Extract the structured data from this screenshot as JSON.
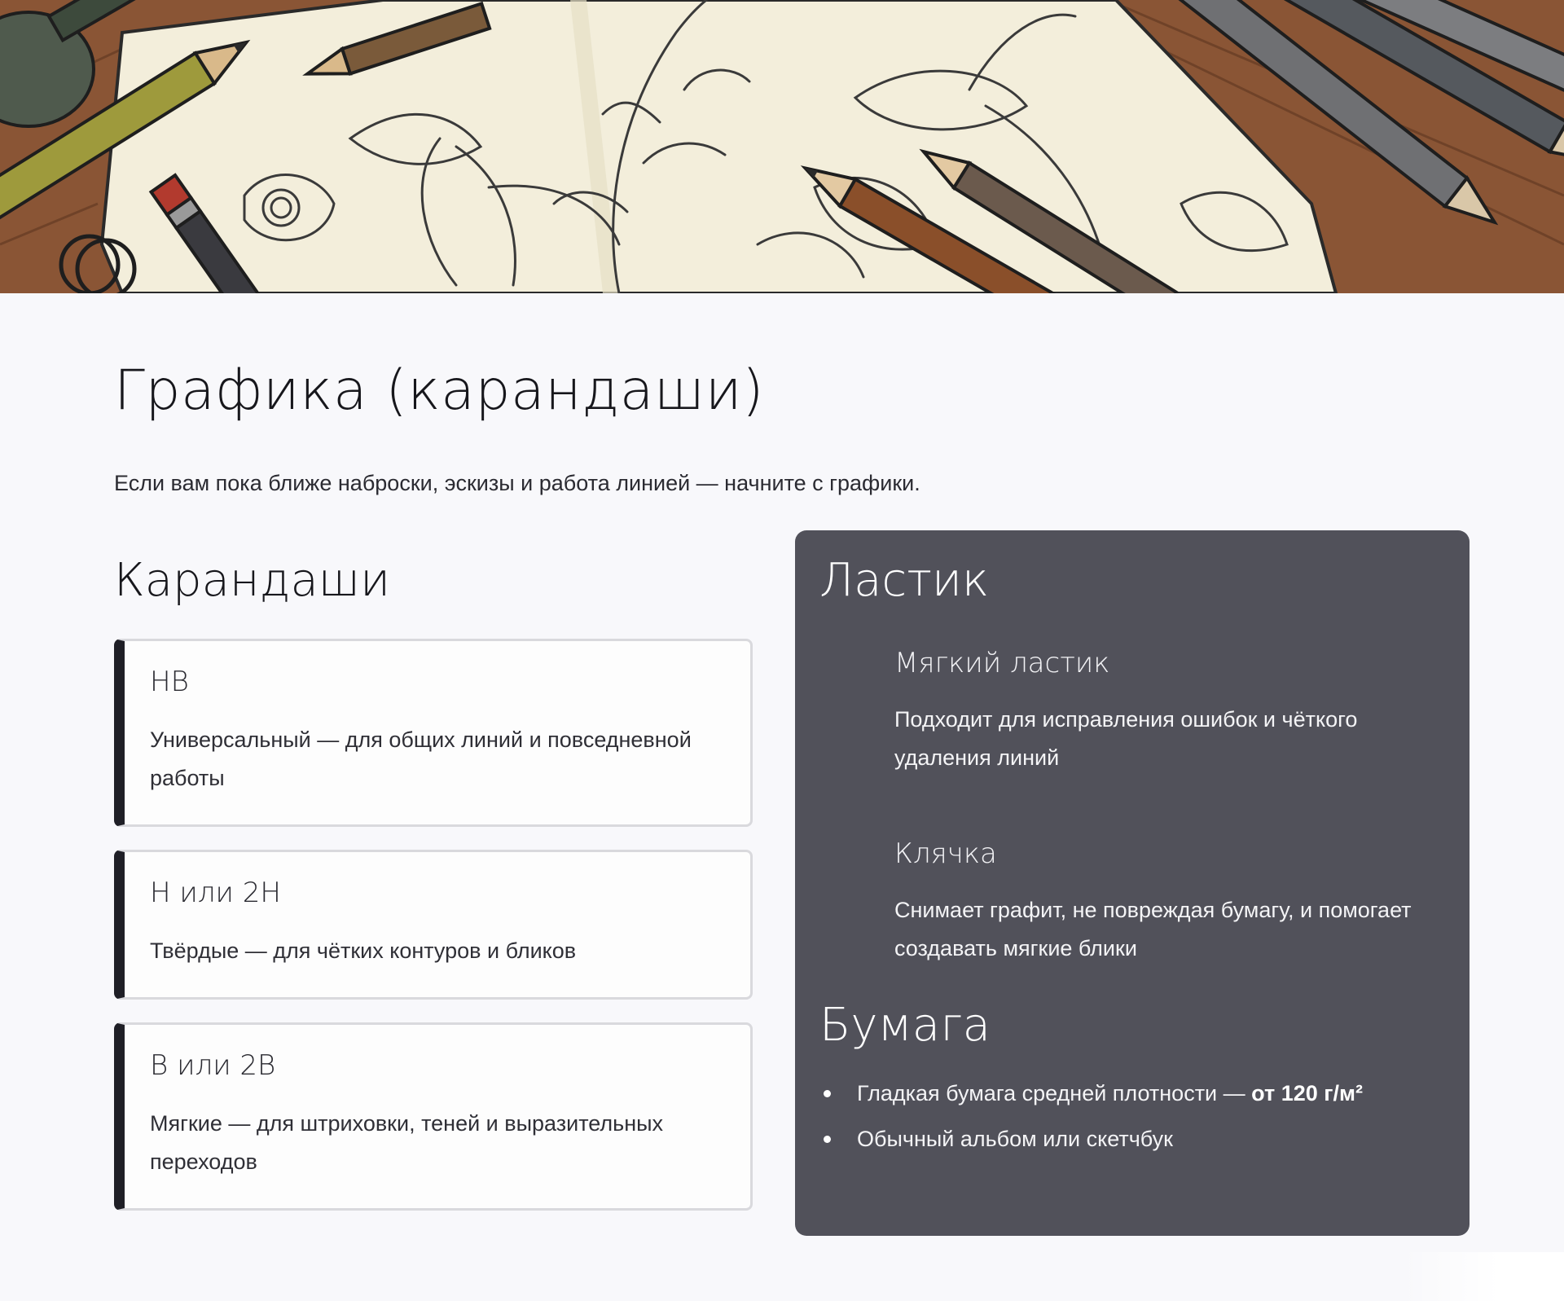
{
  "hero": {
    "image_description_icon": "pencils-sketch-illustration"
  },
  "page": {
    "title": "Графика (карандаши)",
    "intro": "Если вам пока ближе наброски, эскизы и работа линией — начните с графики."
  },
  "pencils": {
    "heading": "Карандаши",
    "items": [
      {
        "title": "HB",
        "desc": "Универсальный — для общих линий и повседневной работы"
      },
      {
        "title": "H или 2H",
        "desc": "Твёрдые — для чётких контуров и бликов"
      },
      {
        "title": "B или 2B",
        "desc": "Мягкие — для штриховки, теней и выразительных переходов"
      }
    ]
  },
  "eraser": {
    "heading": "Ластик",
    "items": [
      {
        "title": "Мягкий ластик",
        "desc": "Подходит для исправления ошибок и чёткого удаления линий"
      },
      {
        "title": "Клячка",
        "desc": "Снимает графит, не повреждая бумагу, и помогает создавать мягкие блики"
      }
    ]
  },
  "paper": {
    "heading": "Бумага",
    "items": [
      {
        "text": "Гладкая бумага средней плотности — ",
        "bold": "от 120 г/м²"
      },
      {
        "text": "Обычный альбом или скетчбук",
        "bold": ""
      }
    ]
  },
  "colors": {
    "background": "#f8f8fb",
    "panel": "#51515a",
    "card_accent": "#1f1f26",
    "card_border": "#d9d9dd"
  }
}
